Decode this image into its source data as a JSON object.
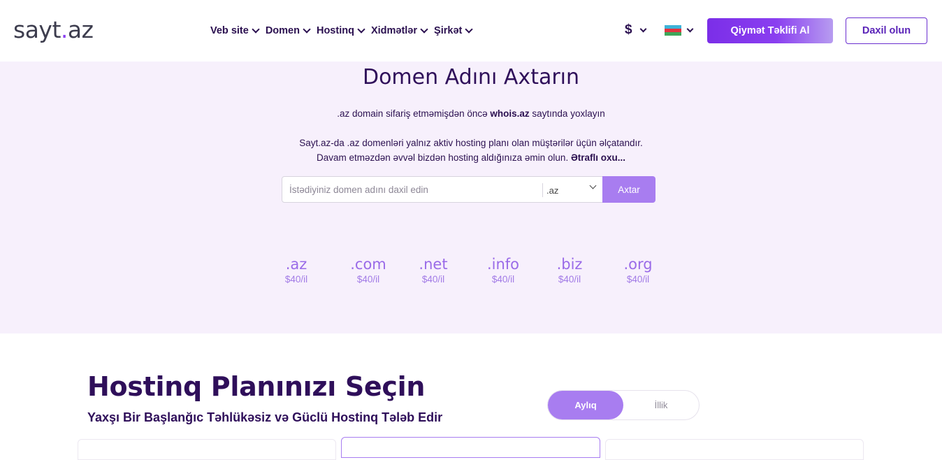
{
  "header": {
    "logo_main": "sayt",
    "logo_dot": ".",
    "logo_tld": "az",
    "nav": [
      {
        "label": "Veb site"
      },
      {
        "label": "Domen"
      },
      {
        "label": "Hostinq"
      },
      {
        "label": "Xidmətlər"
      },
      {
        "label": "Şirkət"
      }
    ],
    "currency": "$",
    "language_flag": "azerbaijan-flag-icon",
    "quote_button": "Qiymət Təklifi Al",
    "login_button": "Daxil olun"
  },
  "domain_search": {
    "title": "Domen Adını Axtarın",
    "note_before": ".az domain sifariş etməmişdən öncə ",
    "note_link": "whois.az",
    "note_after": " saytında yoxlayın",
    "info_line1": "Sayt.az-da .az domenləri yalnız aktiv hosting planı olan müştərilər üçün əlçatandır.",
    "info_line2": "Davam etməzdən əvvəl bizdən hosting aldığınıza əmin olun. ",
    "info_link": "Ətraflı oxu...",
    "input_placeholder": "İstədiyiniz domen adını daxil edin",
    "selected_tld": ".az",
    "search_button": "Axtar",
    "tlds": [
      {
        "name": ".az",
        "price": "$40/il"
      },
      {
        "name": ".com",
        "price": "$40/il"
      },
      {
        "name": ".net",
        "price": "$40/il"
      },
      {
        "name": ".info",
        "price": "$40/il"
      },
      {
        "name": ".biz",
        "price": "$40/il"
      },
      {
        "name": ".org",
        "price": "$40/il"
      }
    ]
  },
  "hosting": {
    "title": "Hostinq Planınızı Seçin",
    "subtitle": "Yaxşı Bir Başlanğıc Təhlükəsiz və Güclü Hostinq Tələb Edir",
    "billing_monthly": "Aylıq",
    "billing_yearly": "İllik"
  },
  "colors": {
    "brand_purple": "#8a3ff0",
    "light_purple": "#a87df0",
    "heading": "#2f0f5a",
    "section_bg": "#f7f0fc"
  }
}
